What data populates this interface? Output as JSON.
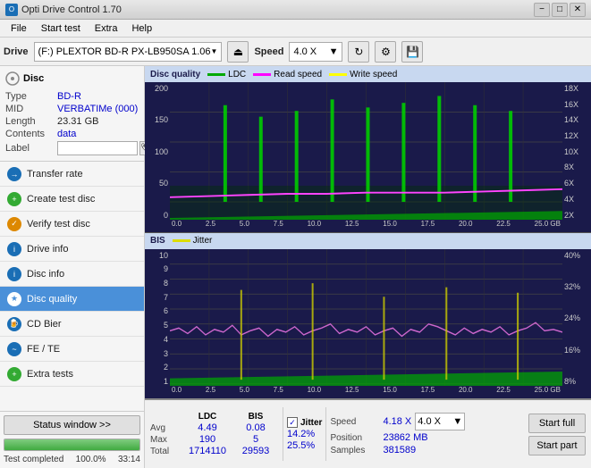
{
  "titlebar": {
    "title": "Opti Drive Control 1.70",
    "icon": "O",
    "minimize": "−",
    "maximize": "□",
    "close": "✕"
  },
  "menubar": {
    "items": [
      "File",
      "Start test",
      "Extra",
      "Help"
    ]
  },
  "toolbar": {
    "drive_label": "Drive",
    "drive_value": "(F:) PLEXTOR BD-R  PX-LB950SA 1.06",
    "speed_label": "Speed",
    "speed_value": "4.0 X"
  },
  "disc": {
    "title": "Disc",
    "type_label": "Type",
    "type_value": "BD-R",
    "mid_label": "MID",
    "mid_value": "VERBATIMe (000)",
    "length_label": "Length",
    "length_value": "23.31 GB",
    "contents_label": "Contents",
    "contents_value": "data",
    "label_label": "Label"
  },
  "nav": {
    "items": [
      {
        "id": "transfer-rate",
        "label": "Transfer rate",
        "active": false
      },
      {
        "id": "create-test-disc",
        "label": "Create test disc",
        "active": false
      },
      {
        "id": "verify-test-disc",
        "label": "Verify test disc",
        "active": false
      },
      {
        "id": "drive-info",
        "label": "Drive info",
        "active": false
      },
      {
        "id": "disc-info",
        "label": "Disc info",
        "active": false
      },
      {
        "id": "disc-quality",
        "label": "Disc quality",
        "active": true
      },
      {
        "id": "cd-bier",
        "label": "CD Bier",
        "active": false
      },
      {
        "id": "fe-te",
        "label": "FE / TE",
        "active": false
      },
      {
        "id": "extra-tests",
        "label": "Extra tests",
        "active": false
      }
    ]
  },
  "status": {
    "button_label": "Status window >>",
    "progress": 100,
    "progress_text": "100.0%",
    "time": "33:14",
    "completed": "Test completed"
  },
  "chart1": {
    "title": "Disc quality",
    "legend": [
      {
        "label": "LDC",
        "color": "#00ff00"
      },
      {
        "label": "Read speed",
        "color": "#ff00ff"
      },
      {
        "label": "Write speed",
        "color": "#ffff00"
      }
    ],
    "y_left": [
      "200",
      "150",
      "100",
      "50",
      "0"
    ],
    "y_right": [
      "18X",
      "16X",
      "14X",
      "12X",
      "10X",
      "8X",
      "6X",
      "4X",
      "2X"
    ],
    "x_labels": [
      "0.0",
      "2.5",
      "5.0",
      "7.5",
      "10.0",
      "12.5",
      "15.0",
      "17.5",
      "20.0",
      "22.5",
      "25.0 GB"
    ]
  },
  "chart2": {
    "title": "BIS",
    "legend": [
      {
        "label": "Jitter",
        "color": "#dddd00"
      }
    ],
    "y_left": [
      "10",
      "9",
      "8",
      "7",
      "6",
      "5",
      "4",
      "3",
      "2",
      "1"
    ],
    "y_right": [
      "40%",
      "32%",
      "24%",
      "16%",
      "8%"
    ],
    "x_labels": [
      "0.0",
      "2.5",
      "5.0",
      "7.5",
      "10.0",
      "12.5",
      "15.0",
      "17.5",
      "20.0",
      "22.5",
      "25.0 GB"
    ]
  },
  "stats": {
    "headers": [
      "LDC",
      "BIS",
      "",
      "Jitter",
      "Speed",
      ""
    ],
    "avg_label": "Avg",
    "avg_ldc": "4.49",
    "avg_bis": "0.08",
    "avg_jitter": "14.2%",
    "max_label": "Max",
    "max_ldc": "190",
    "max_bis": "5",
    "max_jitter": "25.5%",
    "total_label": "Total",
    "total_ldc": "1714110",
    "total_bis": "29593",
    "speed_label": "Speed",
    "speed_val": "4.18 X",
    "position_label": "Position",
    "position_val": "23862 MB",
    "samples_label": "Samples",
    "samples_val": "381589",
    "speed_select": "4.0 X",
    "start_full": "Start full",
    "start_part": "Start part",
    "jitter_checked": true,
    "jitter_label": "Jitter"
  }
}
